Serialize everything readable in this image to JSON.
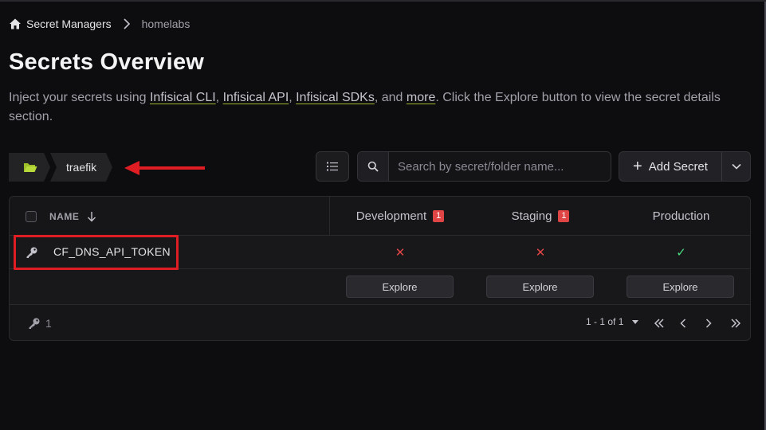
{
  "breadcrumb": {
    "home_label": "Secret Managers",
    "project": "homelabs"
  },
  "page": {
    "title": "Secrets Overview",
    "description_prefix": "Inject your secrets using ",
    "link_cli": "Infisical CLI",
    "sep1": ", ",
    "link_api": "Infisical API",
    "sep2": ", ",
    "link_sdks": "Infisical SDKs",
    "sep3": ", and ",
    "link_more": "more",
    "description_suffix": ". Click the Explore button to view the secret details section."
  },
  "folder_path": {
    "current": "traefik"
  },
  "toolbar": {
    "search_placeholder": "Search by secret/folder name...",
    "add_secret_label": "Add Secret"
  },
  "table": {
    "name_header": "NAME",
    "environments": [
      {
        "name": "Development",
        "badge": "1"
      },
      {
        "name": "Staging",
        "badge": "1"
      },
      {
        "name": "Production",
        "badge": ""
      }
    ],
    "rows": [
      {
        "name": "CF_DNS_API_TOKEN",
        "status": [
          "missing",
          "missing",
          "present"
        ]
      }
    ],
    "explore_label": "Explore",
    "status_missing_glyph": "✕",
    "status_present_glyph": "✓"
  },
  "footer": {
    "secret_count": "1",
    "pagination": "1 - 1 of 1"
  },
  "colors": {
    "accent_underline": "#a3b535",
    "badge_red": "#e04545",
    "missing_red": "#e04545",
    "present_green": "#4ade80",
    "annotation_red": "#e11d24"
  }
}
